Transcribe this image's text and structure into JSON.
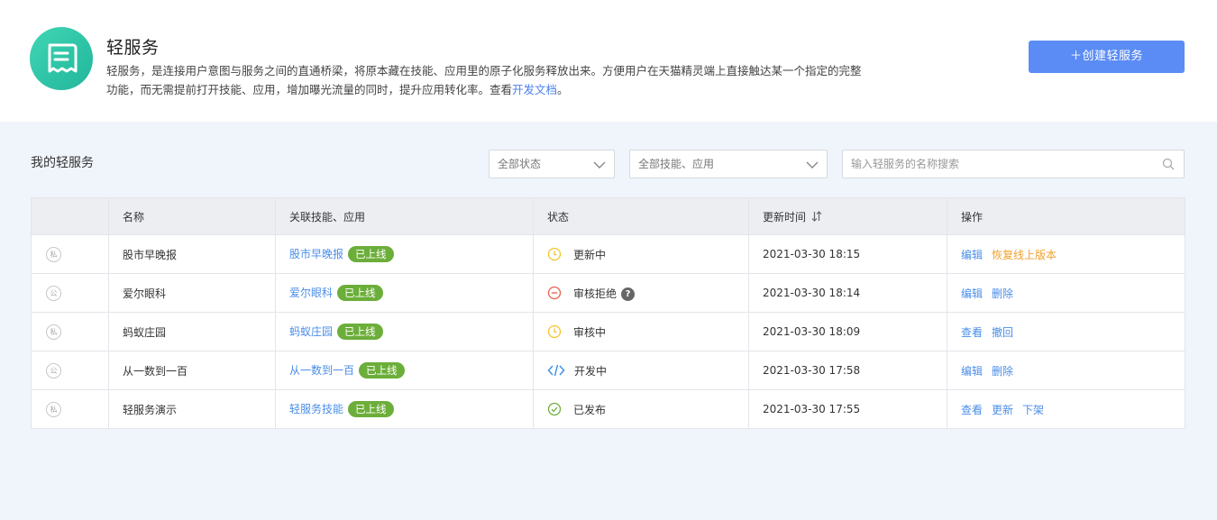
{
  "header": {
    "title": "轻服务",
    "desc_main": "轻服务，是连接用户意图与服务之间的直通桥梁，将原本藏在技能、应用里的原子化服务释放出来。方便用户在天猫精灵端上直接触达某一个指定的完整功能，而无需提前打开技能、应用，增加曝光流量的同时，提升应用转化率。查看",
    "desc_link": "开发文档",
    "desc_end": "。",
    "create_button": "＋创建轻服务",
    "logo_icon": "list-document-icon",
    "logo_color": "#2cc4a6"
  },
  "section": {
    "title": "我的轻服务"
  },
  "filters": {
    "status": "全部状态",
    "skill": "全部技能、应用",
    "search_placeholder": "输入轻服务的名称搜索"
  },
  "table": {
    "columns": [
      "",
      "名称",
      "关联技能、应用",
      "状态",
      "更新时间",
      "操作"
    ],
    "rows": [
      {
        "vis": "私",
        "name": "股市早晚报",
        "skill": "股市早晚报",
        "badge": "已上线",
        "status_icon": "clock-icon",
        "status": "更新中",
        "help": "",
        "time": "2021-03-30 18:15",
        "ops": [
          "编辑",
          "恢复线上版本"
        ]
      },
      {
        "vis": "公",
        "name": "爱尔眼科",
        "skill": "爱尔眼科",
        "badge": "已上线",
        "status_icon": "reject-icon",
        "status": "审核拒绝",
        "help": "?",
        "time": "2021-03-30 18:14",
        "ops": [
          "编辑",
          "删除"
        ]
      },
      {
        "vis": "私",
        "name": "蚂蚁庄园",
        "skill": "蚂蚁庄园",
        "badge": "已上线",
        "status_icon": "clock-icon",
        "status": "审核中",
        "help": "",
        "time": "2021-03-30 18:09",
        "ops": [
          "查看",
          "撤回"
        ]
      },
      {
        "vis": "公",
        "name": "从一数到一百",
        "skill": "从一数到一百",
        "badge": "已上线",
        "status_icon": "code-icon",
        "status": "开发中",
        "help": "",
        "time": "2021-03-30 17:58",
        "ops": [
          "编辑",
          "删除"
        ]
      },
      {
        "vis": "私",
        "name": "轻服务演示",
        "skill": "轻服务技能",
        "badge": "已上线",
        "status_icon": "check-circle-icon",
        "status": "已发布",
        "help": "",
        "time": "2021-03-30 17:55",
        "ops": [
          "查看",
          "更新",
          "下架"
        ]
      }
    ]
  },
  "colors": {
    "accent": "#5b8cf6",
    "link": "#4a8ee8",
    "badge": "#6cae3a",
    "warning": "#f0a12c",
    "clock": "#f5c42b",
    "reject": "#e8604c",
    "code": "#3a8ee8",
    "done": "#6cae3a"
  }
}
